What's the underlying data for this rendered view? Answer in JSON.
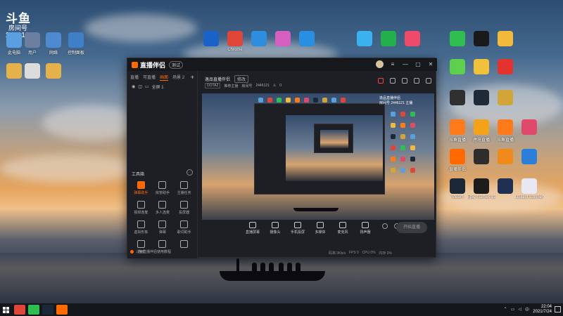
{
  "desktop": {
    "brand": "斗鱼",
    "room_label": "房间号",
    "room_number": "2446121",
    "icons_left": [
      {
        "label": "此电脑",
        "icon": "computer-icon",
        "color": "#5aa0e0"
      },
      {
        "label": "用户",
        "icon": "user-folder-icon",
        "color": "#6b7fa0"
      },
      {
        "label": "网络",
        "icon": "network-icon",
        "color": "#4e8ad0"
      },
      {
        "label": "控制面板",
        "icon": "control-panel-icon",
        "color": "#3f7fc8"
      },
      {
        "label": "",
        "icon": "folder-icon",
        "color": "#e5b14a"
      },
      {
        "label": "",
        "icon": "document-icon",
        "color": "#dcdcdc"
      },
      {
        "label": "",
        "icon": "folder-icon",
        "color": "#e5b14a"
      }
    ],
    "icons_top": [
      {
        "label": "",
        "icon": "maxthon-icon",
        "color": "#1a63c6"
      },
      {
        "label": "Chrome",
        "icon": "chrome-icon",
        "color": "#e0453a"
      },
      {
        "label": "",
        "icon": "browser-icon",
        "color": "#2f8de0"
      },
      {
        "label": "",
        "icon": "colorful-app-icon",
        "color": "#d45fc0"
      },
      {
        "label": "",
        "icon": "edge-icon",
        "color": "#2a8fe0"
      }
    ],
    "icons_right": [
      {
        "label": "",
        "icon": "video-icon",
        "color": "#3bb1f0"
      },
      {
        "label": "",
        "icon": "iqiyi-icon",
        "color": "#22b04c"
      },
      {
        "label": "",
        "icon": "media-icon",
        "color": "#ef4a6a"
      },
      {
        "label": "",
        "icon": "wechat-icon",
        "color": "#2fbe50"
      },
      {
        "label": "",
        "icon": "qq-icon",
        "color": "#1a1a1a"
      },
      {
        "label": "",
        "icon": "penguin-icon",
        "color": "#f3b93c"
      },
      {
        "label": "",
        "icon": "green-app-icon",
        "color": "#5fcf4e"
      },
      {
        "label": "",
        "icon": "yellow-app-icon",
        "color": "#f2c13b"
      },
      {
        "label": "",
        "icon": "netease-music-icon",
        "color": "#e2332f"
      },
      {
        "label": "",
        "icon": "game-icon",
        "color": "#303030"
      },
      {
        "label": "",
        "icon": "game-icon",
        "color": "#1f2a38"
      },
      {
        "label": "",
        "icon": "game-icon",
        "color": "#d2a538"
      },
      {
        "label": "斗鱼直播",
        "icon": "douyu-icon",
        "color": "#ff7a1a"
      },
      {
        "label": "虎牙直播",
        "icon": "huya-icon",
        "color": "#f4a318"
      },
      {
        "label": "斗鱼直播",
        "icon": "douyu-icon",
        "color": "#ff7a1a"
      },
      {
        "label": "",
        "icon": "app-icon",
        "color": "#e04a6a"
      },
      {
        "label": "直播伴侣",
        "icon": "stream-companion-icon",
        "color": "#ff6a00"
      },
      {
        "label": "",
        "icon": "app-icon",
        "color": "#2d2d2d"
      },
      {
        "label": "",
        "icon": "app-icon",
        "color": "#f08a1a"
      },
      {
        "label": "",
        "icon": "app-icon",
        "color": "#2c7fd8"
      },
      {
        "label": "Steam",
        "icon": "steam-icon",
        "color": "#1a2838"
      },
      {
        "label": "Epic Games Launcher",
        "icon": "epic-icon",
        "color": "#1c1c1c"
      },
      {
        "label": "",
        "icon": "app-icon",
        "color": "#203050"
      },
      {
        "label": "Ubisoft Connect",
        "icon": "ubisoft-icon",
        "color": "#e8e8f4"
      }
    ]
  },
  "window": {
    "title": "直播伴侣",
    "version_badge": "测试",
    "tabs": [
      "直播",
      "可直播",
      "画面",
      "场景 2"
    ],
    "scene_item": "全屏 1",
    "tools_title": "工具箱",
    "tools": [
      {
        "label": "弹幕助手",
        "icon": "barrage-icon",
        "active": true
      },
      {
        "label": "房管助手",
        "icon": "moderator-icon",
        "active": false
      },
      {
        "label": "主播任务",
        "icon": "task-icon",
        "active": false
      },
      {
        "label": "视频连麦",
        "icon": "video-call-icon",
        "active": false
      },
      {
        "label": "多人连麦",
        "icon": "multi-call-icon",
        "active": false
      },
      {
        "label": "投屏器",
        "icon": "cast-icon",
        "active": false
      },
      {
        "label": "虚拟形象",
        "icon": "avatar-icon",
        "active": false
      },
      {
        "label": "弹幕",
        "icon": "comment-icon",
        "active": false
      },
      {
        "label": "歌词助手",
        "icon": "lyrics-icon",
        "active": false
      },
      {
        "label": "游戏",
        "icon": "game-tool-icon",
        "active": false
      },
      {
        "label": "",
        "icon": "tool-icon",
        "active": false
      },
      {
        "label": "",
        "icon": "tool-icon",
        "active": false
      }
    ],
    "hint": "斗鱼直播伴侣使用教程",
    "room_title": "逸品直播伴侣",
    "edit_label": "修改",
    "meta": {
      "category": "DOTA2",
      "sub": "推荐主播",
      "room_label": "房间号",
      "room_number": "2446121",
      "count": "0"
    },
    "preview_overlay": [
      "逸品直播伴侣",
      "房间号 2446121 主播"
    ],
    "controls": [
      {
        "label": "直播屏幕",
        "icon": "screen-icon"
      },
      {
        "label": "摄像头",
        "icon": "camera-icon"
      },
      {
        "label": "手机投屏",
        "icon": "phone-cast-icon"
      },
      {
        "label": "多媒体",
        "icon": "media-file-icon"
      },
      {
        "label": "麦克风",
        "icon": "microphone-icon"
      },
      {
        "label": "扬声器",
        "icon": "speaker-icon"
      }
    ],
    "start_button": "开始直播",
    "status": [
      "码率 0Kb/s",
      "FPS 0",
      "CPU 0%",
      "内存 0%"
    ]
  },
  "taskbar": {
    "apps": [
      {
        "icon": "chrome-taskbar-icon",
        "color": "#e0453a"
      },
      {
        "icon": "wechat-taskbar-icon",
        "color": "#2fbe50"
      },
      {
        "icon": "steam-taskbar-icon",
        "color": "#1a2838"
      },
      {
        "icon": "stream-companion-taskbar-icon",
        "color": "#ff6a00"
      }
    ],
    "tray_lang": "中",
    "time": "22:04",
    "date": "2021/7/24"
  }
}
